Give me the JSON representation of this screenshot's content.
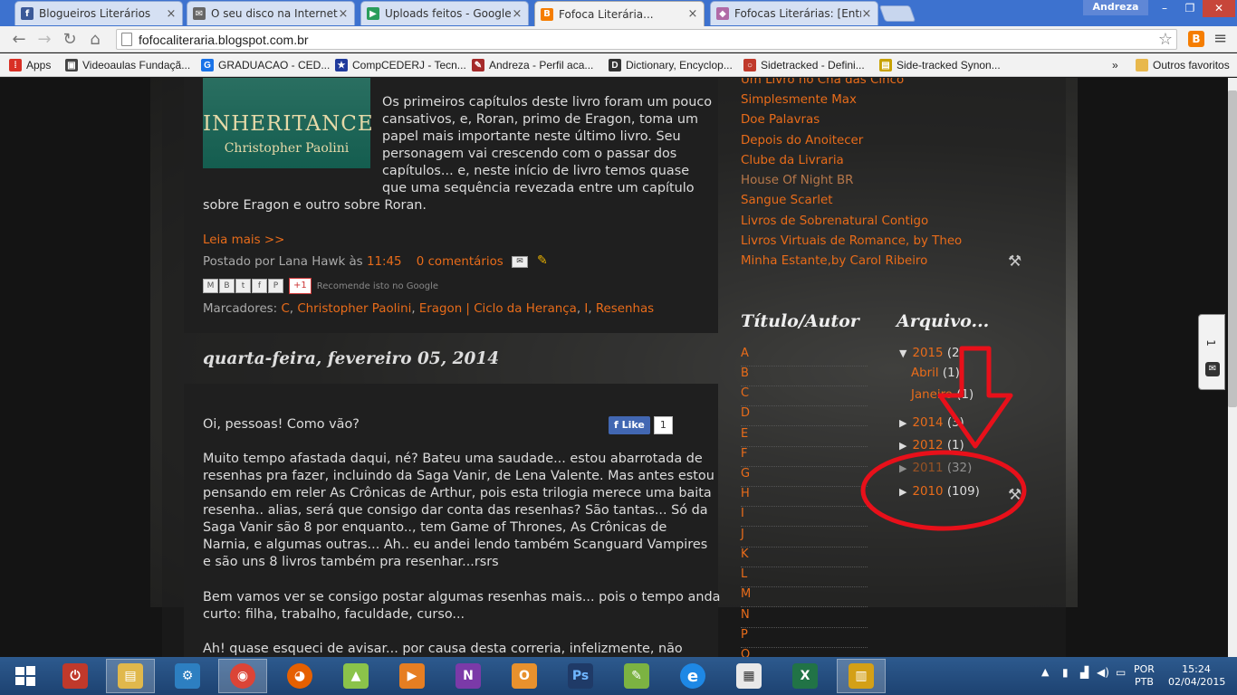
{
  "browser": {
    "tabs": [
      {
        "title": "Blogueiros Literários",
        "icon": "facebook-icon",
        "color": "#3b5998",
        "glyph": "f"
      },
      {
        "title": "O seu disco na Internet - E",
        "icon": "mail-icon",
        "color": "#666666",
        "glyph": "✉"
      },
      {
        "title": "Uploads feitos - Google P",
        "icon": "play-icon",
        "color": "#2a9d5b",
        "glyph": "▶"
      },
      {
        "title": "Fofoca Literária...",
        "icon": "blogger-icon",
        "color": "#f57d00",
        "glyph": "B"
      },
      {
        "title": "Fofocas Literárias: [Entrevi",
        "icon": "book-icon",
        "color": "#b06aa6",
        "glyph": "◆"
      }
    ],
    "user": "Andreza",
    "window_controls": {
      "minimize": "–",
      "maximize": "❐",
      "close": "✕"
    },
    "url": "fofocaliteraria.blogspot.com.br",
    "bookmarks": [
      {
        "label": "Apps",
        "color": "#d93025",
        "glyph": "⁞"
      },
      {
        "label": "Videoaulas Fundaçã...",
        "color": "#444444",
        "glyph": "▣"
      },
      {
        "label": "GRADUACAO - CED...",
        "color": "#1a73e8",
        "glyph": "G"
      },
      {
        "label": "CompCEDERJ - Tecn...",
        "color": "#203a9c",
        "glyph": "★"
      },
      {
        "label": "Andreza - Perfil aca...",
        "color": "#a52a2a",
        "glyph": "✎"
      },
      {
        "label": "Dictionary, Encyclop...",
        "color": "#333333",
        "glyph": "D"
      },
      {
        "label": "Sidetracked - Defini...",
        "color": "#c0392b",
        "glyph": "○"
      },
      {
        "label": "Side-tracked Synon...",
        "color": "#c8a200",
        "glyph": "▤"
      }
    ],
    "bookmarks_more": "»",
    "other_bookmarks": "Outros favoritos"
  },
  "post1": {
    "cover_title": "INHERITANCE",
    "cover_author": "Christopher Paolini",
    "paragraph": [
      "Os primeiros capítulos deste livro foram um pouco",
      "cansativos, e, Roran, primo de Eragon, toma um",
      "papel mais importante neste último livro. Seu",
      "personagem vai crescendo com o passar dos",
      "capítulos... e, neste início de livro temos quase",
      "que uma sequência revezada entre um capítulo",
      "sobre Eragon e outro sobre Roran."
    ],
    "read_more": "Leia mais >>",
    "posted_by": "Postado por Lana Hawk às",
    "time": "11:45",
    "comments": "0 comentários",
    "recommend": "Recomende isto no Google",
    "gplus": "+1",
    "labels_title": "Marcadores:",
    "labels": [
      ", ",
      ", ",
      ", ",
      ", "
    ],
    "label_links": [
      "C",
      "Christopher Paolini",
      "Eragon | Ciclo da Herança",
      "I",
      "Resenhas"
    ]
  },
  "post2": {
    "date": "quarta-feira, fevereiro 05, 2014",
    "like_label": "Like",
    "like_count": "1",
    "greeting": "Oi, pessoas! Como vão?",
    "para1": [
      "Muito tempo afastada daqui, né? Bateu uma saudade... estou abarrotada de",
      "resenhas pra fazer, incluindo da Saga Vanir, de Lena Valente. Mas antes estou",
      "pensando em reler As Crônicas de Arthur, pois esta trilogia merece uma baita",
      "resenha.. alias, será que consigo dar conta das resenhas? São tantas... Só da",
      "Saga Vanir são 8 por enquanto.., tem Game of Thrones, As Crônicas de",
      "Narnia, e algumas outras... Ah.. eu andei lendo também Scanguard Vampires",
      "e são uns 8 livros também pra resenhar...rsrs"
    ],
    "para2": [
      "Bem vamos ver se consigo postar algumas resenhas mais... pois o tempo anda",
      "curto: filha, trabalho, faculdade, curso..."
    ],
    "para3": "Ah! quase esqueci de avisar... por causa desta correria, infelizmente, não"
  },
  "sidebar": {
    "blog_links": [
      "Um Livro no Chá das Cinco",
      "Simplesmente Max",
      "Doe Palavras",
      "Depois do Anoitecer",
      "Clube da Livraria",
      "House Of Night BR",
      "Sangue Scarlet",
      "Livros de Sobrenatural Contigo",
      "Livros Virtuais de Romance, by Theo",
      "Minha Estante,by Carol Ribeiro"
    ],
    "title_author_heading": "Título/Autor",
    "letters": [
      "A",
      "B",
      "C",
      "D",
      "E",
      "F",
      "G",
      "H",
      "I",
      "J",
      "K",
      "L",
      "M",
      "N",
      "P",
      "Q"
    ],
    "archive_heading": "Arquivo...",
    "archive": {
      "y2015": {
        "tri": "▼",
        "year": "2015",
        "count": "(2)"
      },
      "abril": {
        "month": "Abril",
        "count": "(1)"
      },
      "janeiro": {
        "month": "Janeiro",
        "count": "(1)"
      },
      "y2014": {
        "tri": "▶",
        "year": "2014",
        "count": "(3)"
      },
      "y2012": {
        "tri": "▶",
        "year": "2012",
        "count": "(1)"
      },
      "y2011": {
        "tri": "▶",
        "year": "2011",
        "count": "(32)"
      },
      "y2010": {
        "tri": "▶",
        "year": "2010",
        "count": "(109)"
      }
    }
  },
  "feedback_widget": {
    "count": "1"
  },
  "taskbar": {
    "icons": [
      {
        "name": "power-icon",
        "color": "#c0392b",
        "glyph": "⏻"
      },
      {
        "name": "file-explorer-icon",
        "color": "#e0b84c",
        "glyph": "▤"
      },
      {
        "name": "control-panel-icon",
        "color": "#2d7fc1",
        "glyph": "⚙"
      },
      {
        "name": "chrome-icon",
        "color": "#db4437",
        "glyph": "◉"
      },
      {
        "name": "firefox-icon",
        "color": "#e66000",
        "glyph": "◕"
      },
      {
        "name": "photos-icon",
        "color": "#8bc34a",
        "glyph": "▲"
      },
      {
        "name": "video-icon",
        "color": "#e67e22",
        "glyph": "▶"
      },
      {
        "name": "onenote-icon",
        "color": "#7b3aa8",
        "glyph": "N"
      },
      {
        "name": "outlook-icon",
        "color": "#e8912d",
        "glyph": "O"
      },
      {
        "name": "photoshop-icon",
        "color": "#1f3a67",
        "glyph": "Ps"
      },
      {
        "name": "coreldraw-icon",
        "color": "#7cb342",
        "glyph": "✎"
      },
      {
        "name": "ie-icon",
        "color": "#1e88e5",
        "glyph": "e"
      },
      {
        "name": "network-icon",
        "color": "#e8e8e8",
        "glyph": "▦"
      },
      {
        "name": "excel-icon",
        "color": "#217346",
        "glyph": "X"
      },
      {
        "name": "library-icon",
        "color": "#d4a017",
        "glyph": "▥"
      }
    ],
    "language": "POR",
    "keyboard": "PTB",
    "time": "15:24",
    "date": "02/04/2015"
  },
  "colors": {
    "link": "#e96c1a",
    "annotation": "#e8101a"
  }
}
